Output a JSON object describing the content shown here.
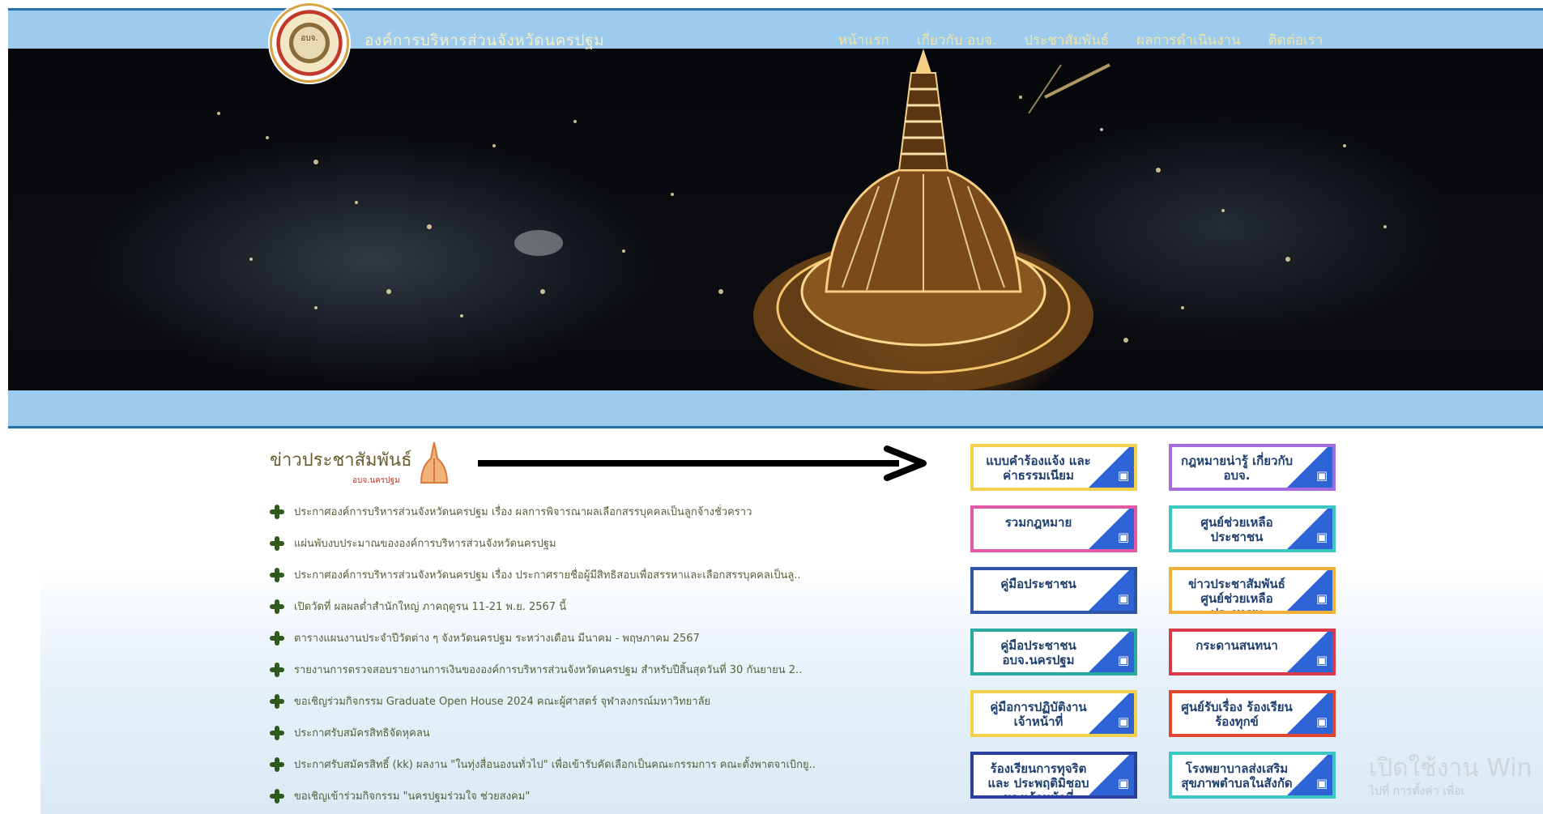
{
  "header": {
    "site_title": "องค์การบริหารส่วนจังหวัดนครปฐม",
    "logo_text": "อบจ.",
    "nav": [
      "หน้าแรก",
      "เกี่ยวกับ อบจ.",
      "ประชาสัมพันธ์",
      "ผลการดำเนินงาน",
      "ติดต่อเรา"
    ]
  },
  "news": {
    "heading": "ข่าวประชาสัมพันธ์",
    "subheading": "อบจ.นครปฐม",
    "items": [
      "ประกาศองค์การบริหารส่วนจังหวัดนครปฐม เรื่อง ผลการพิจารณาผลเลือกสรรบุคคลเป็นลูกจ้างชั่วคราว",
      "แผ่นพับงบประมาณขององค์การบริหารส่วนจังหวัดนครปฐม",
      "ประกาศองค์การบริหารส่วนจังหวัดนครปฐม เรื่อง ประกาศรายชื่อผู้มีสิทธิสอบเพื่อสรรหาและเลือกสรรบุคคลเป็นลู..",
      "เปิดวัดที่ ผลผลต่ำสำนักใหญ่ ภาคฤดูรน 11-21 พ.ย. 2567 นี้",
      "ตารางแผนงานประจำปีวัดต่าง ๆ จังหวัดนครปฐม ระหว่างเดือน มีนาคม - พฤษภาคม 2567",
      "รายงานการตรวจสอบรายงานการเงินขององค์การบริหารส่วนจังหวัดนครปฐม สำหรับปีสิ้นสุดวันที่ 30 กันยายน 2..",
      "ขอเชิญร่วมกิจกรรม Graduate Open House 2024 คณะผู้ศาสตร์ จุฬาลงกรณ์มหาวิทยาลัย",
      "ประกาศรับสมัครสิทธิจัดหุคลน",
      "ประกาศรับสมัครสิทธิ์ (kk) ผลงาน \"ในทุ่งสื่อนองนทั่วไป\" เพื่อเข้ารับคัดเลือกเป็นคณะกรรมการ คณะตั้งพาตจาเบิกยู..",
      "ขอเชิญเข้าร่วมกิจกรรม \"นครปฐมร่วมใจ ช่วยสงคม\""
    ]
  },
  "quick_links": [
    {
      "label": "แบบคำร้องแจ้ง และค่าธรรมเนียม",
      "border": "#f2d24c",
      "icon": "document-icon"
    },
    {
      "label": "กฎหมายน่ารู้ เกี่ยวกับ อบจ.",
      "border": "#a56ce0",
      "icon": "book-icon"
    },
    {
      "label": "รวมกฎหมาย",
      "border": "#e35aa8",
      "icon": "law-icon"
    },
    {
      "label": "ศูนย์ช่วยเหลือ ประชาชน",
      "border": "#3cc7c2",
      "icon": "help-icon"
    },
    {
      "label": "คู่มือประชาชน",
      "border": "#2e55a8",
      "icon": "manual-icon"
    },
    {
      "label": "ข่าวประชาสัมพันธ์ ศูนย์ช่วยเหลือประชาชน",
      "border": "#f0b23a",
      "icon": "news-icon"
    },
    {
      "label": "คู่มือประชาชน อบจ.นครปฐม",
      "border": "#2aa9a0",
      "icon": "manual-icon"
    },
    {
      "label": "กระดานสนทนา",
      "border": "#d93a4a",
      "icon": "chat-icon"
    },
    {
      "label": "คู่มือการปฏิบัติงาน เจ้าหน้าที่",
      "border": "#f2d24c",
      "icon": "guide-icon"
    },
    {
      "label": "ศูนย์รับเรื่อง ร้องเรียนร้องทุกข์",
      "border": "#e0452e",
      "icon": "complaint-icon"
    },
    {
      "label": "ร้องเรียนการทุจริตและ ประพฤติมิชอบของเจ้าหน้าที่",
      "border": "#2a3f9e",
      "icon": "report-icon"
    },
    {
      "label": "โรงพยาบาลส่งเสริม สุขภาพตำบลในสังกัด",
      "border": "#3cc7c2",
      "icon": "hospital-icon"
    }
  ],
  "watermark": {
    "line1": "เปิดใช้งาน Win",
    "line2": "ไปที่ การตั้งค่า เพื่อเ"
  }
}
